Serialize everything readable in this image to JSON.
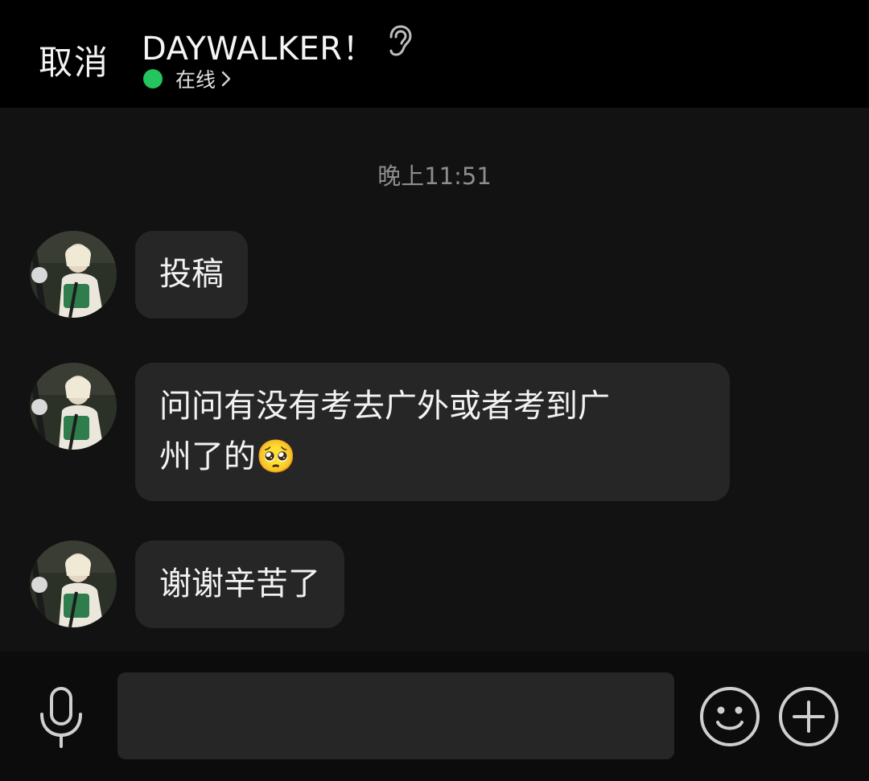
{
  "header": {
    "cancel_label": "取消",
    "title": "DAYWALKER！",
    "status_text": "在线",
    "status_color": "#22c55e"
  },
  "conversation": {
    "timestamp": "晚上11:51",
    "messages": [
      {
        "text": "投稿"
      },
      {
        "text_line1": "问问有没有考去广外或者考到广",
        "text_line2": "州了的🥺"
      },
      {
        "text": "谢谢辛苦了"
      }
    ]
  },
  "input": {
    "placeholder": "",
    "value": ""
  },
  "icons": {
    "ear": "ear-icon",
    "chevron": "chevron-right-icon",
    "mic": "microphone-icon",
    "emoji": "smiley-icon",
    "plus": "plus-circle-icon"
  }
}
